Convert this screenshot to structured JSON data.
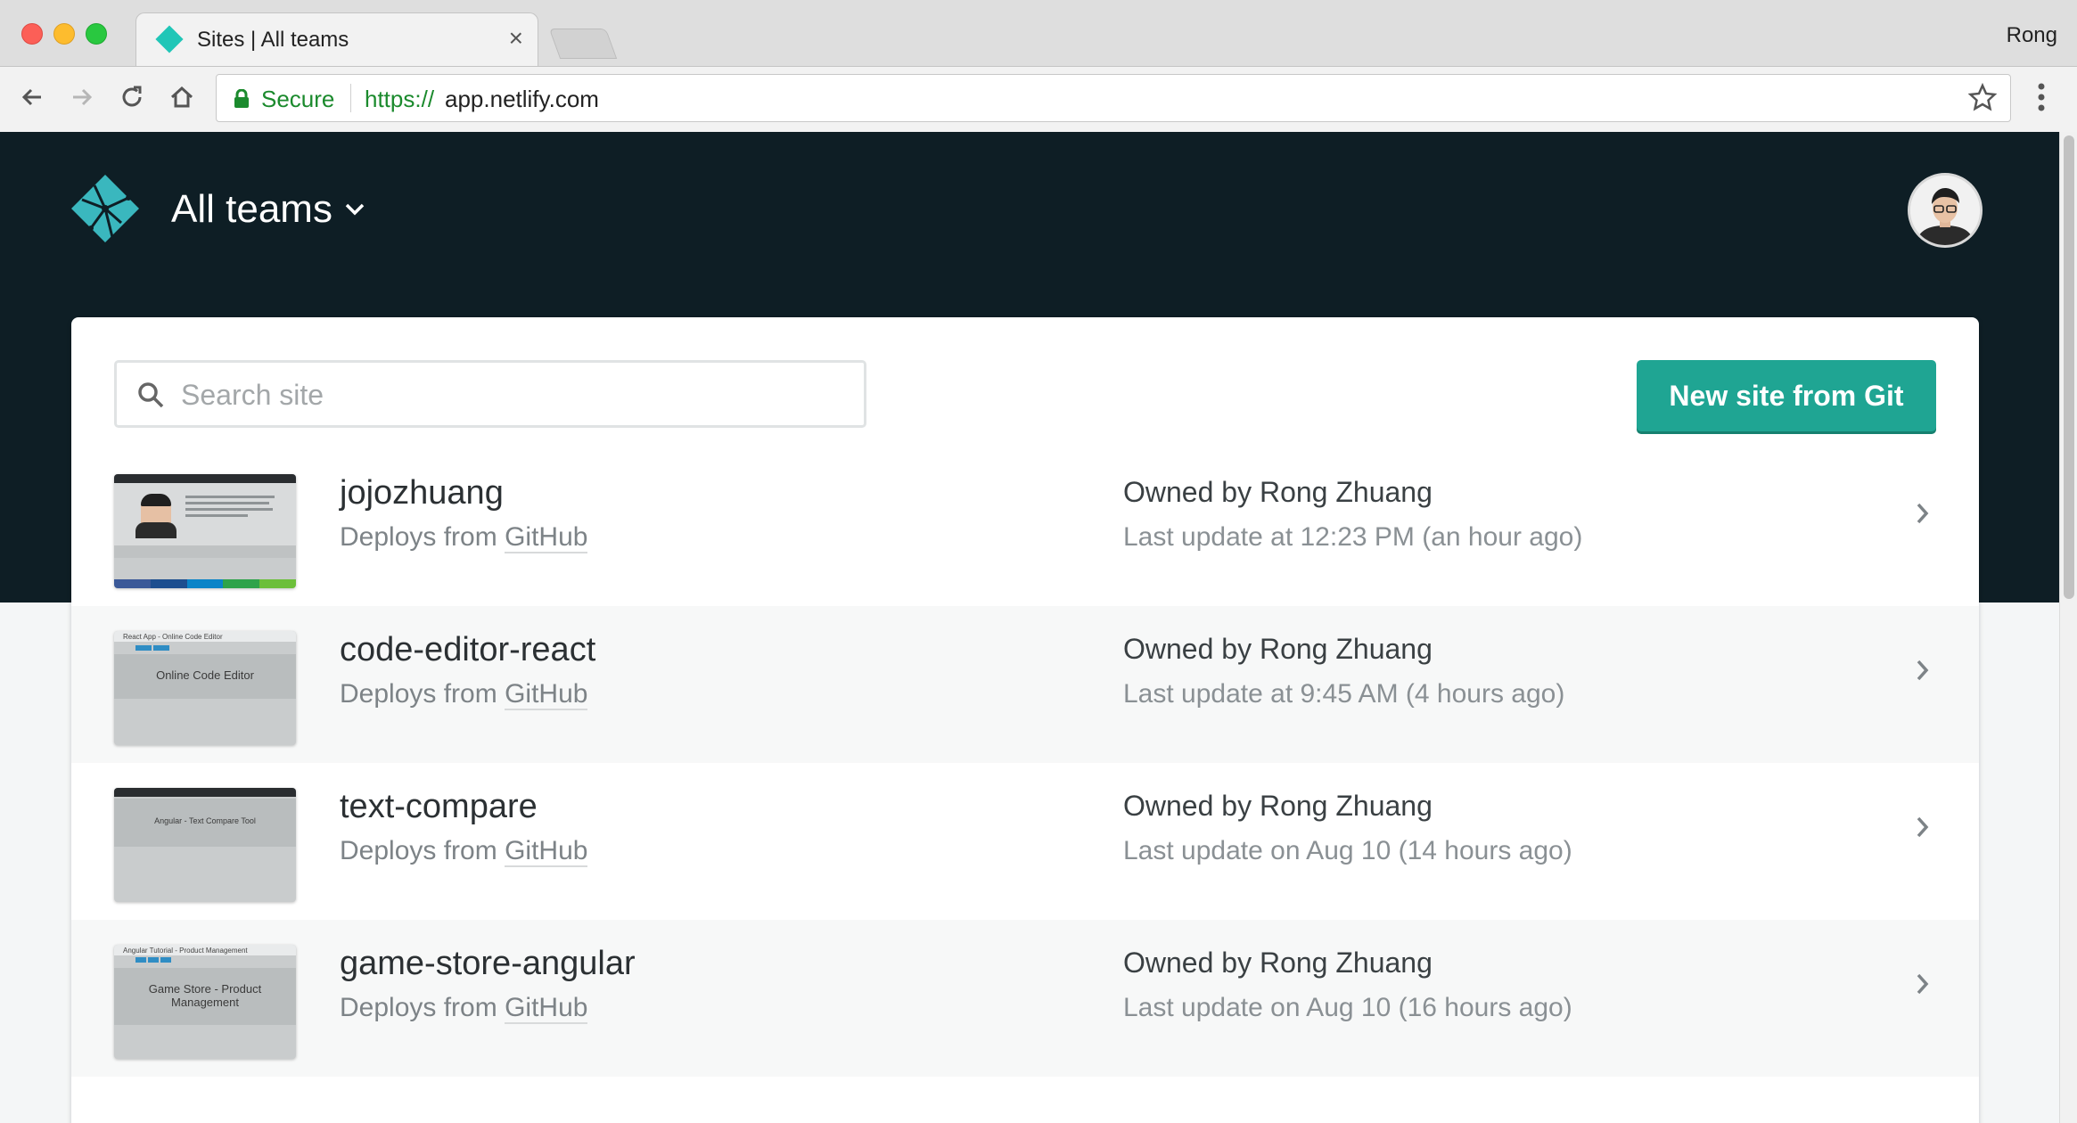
{
  "browser": {
    "tab_title": "Sites | All teams",
    "profile_name": "Rong",
    "url_secure_label": "Secure",
    "url_scheme": "https://",
    "url_host": "app.netlify.com"
  },
  "header": {
    "team_label": "All teams"
  },
  "main": {
    "search_placeholder": "Search site",
    "new_site_button": "New site from Git",
    "sites": [
      {
        "name": "jojozhuang",
        "deploy_prefix": "Deploys from",
        "deploy_source": "GitHub",
        "owner_prefix": "Owned by",
        "owner": "Rong Zhuang",
        "updated": "Last update at 12:23 PM (an hour ago)",
        "thumb_title": "",
        "thumb_heading": ""
      },
      {
        "name": "code-editor-react",
        "deploy_prefix": "Deploys from",
        "deploy_source": "GitHub",
        "owner_prefix": "Owned by",
        "owner": "Rong Zhuang",
        "updated": "Last update at 9:45 AM (4 hours ago)",
        "thumb_title": "React App - Online Code Editor",
        "thumb_heading": "Online Code Editor"
      },
      {
        "name": "text-compare",
        "deploy_prefix": "Deploys from",
        "deploy_source": "GitHub",
        "owner_prefix": "Owned by",
        "owner": "Rong Zhuang",
        "updated": "Last update on Aug 10 (14 hours ago)",
        "thumb_title": "",
        "thumb_heading": "Angular - Text Compare Tool"
      },
      {
        "name": "game-store-angular",
        "deploy_prefix": "Deploys from",
        "deploy_source": "GitHub",
        "owner_prefix": "Owned by",
        "owner": "Rong Zhuang",
        "updated": "Last update on Aug 10 (16 hours ago)",
        "thumb_title": "Angular Tutorial - Product Management",
        "thumb_heading": "Game Store - Product Management"
      }
    ]
  },
  "colors": {
    "header_bg": "#0e1e25",
    "accent_teal": "#1fa593",
    "netlify_logo": "#3ab7be",
    "secure_green": "#1b8a2d"
  }
}
